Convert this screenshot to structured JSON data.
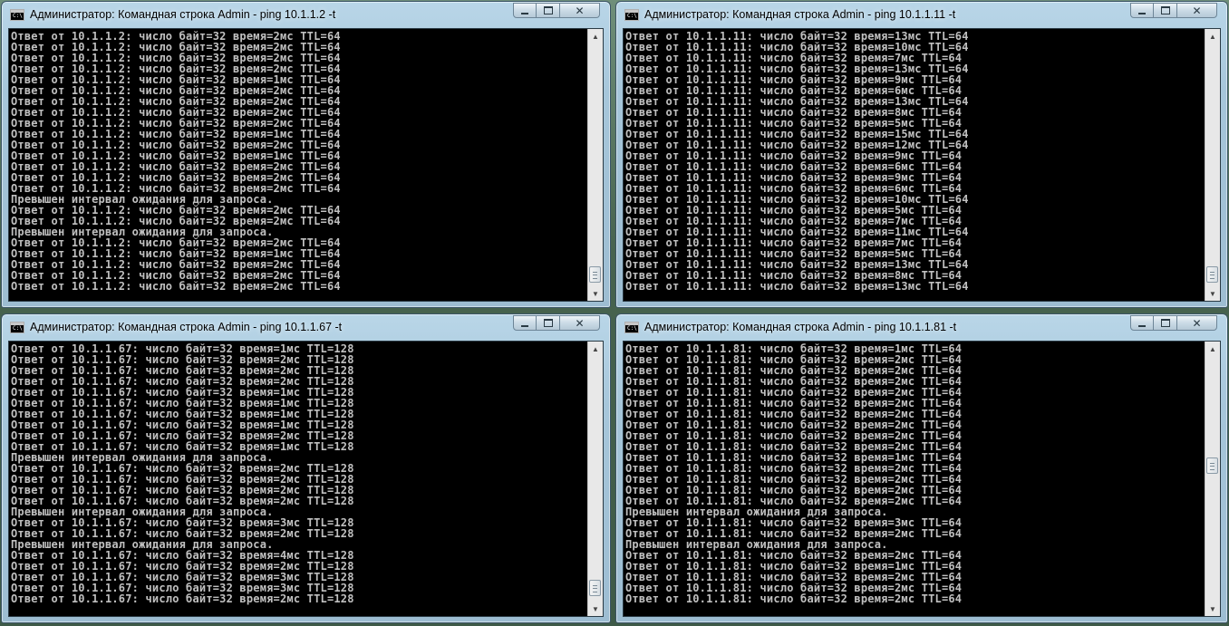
{
  "windows": [
    {
      "title": "Администратор: Командная строка Admin - ping  10.1.1.2 -t",
      "icon": "C:\\",
      "lines": [
        "Ответ от 10.1.1.2: число байт=32 время=2мс TTL=64",
        "Ответ от 10.1.1.2: число байт=32 время=2мс TTL=64",
        "Ответ от 10.1.1.2: число байт=32 время=2мс TTL=64",
        "Ответ от 10.1.1.2: число байт=32 время=2мс TTL=64",
        "Ответ от 10.1.1.2: число байт=32 время=1мс TTL=64",
        "Ответ от 10.1.1.2: число байт=32 время=2мс TTL=64",
        "Ответ от 10.1.1.2: число байт=32 время=2мс TTL=64",
        "Ответ от 10.1.1.2: число байт=32 время=2мс TTL=64",
        "Ответ от 10.1.1.2: число байт=32 время=2мс TTL=64",
        "Ответ от 10.1.1.2: число байт=32 время=1мс TTL=64",
        "Ответ от 10.1.1.2: число байт=32 время=2мс TTL=64",
        "Ответ от 10.1.1.2: число байт=32 время=1мс TTL=64",
        "Ответ от 10.1.1.2: число байт=32 время=2мс TTL=64",
        "Ответ от 10.1.1.2: число байт=32 время=2мс TTL=64",
        "Ответ от 10.1.1.2: число байт=32 время=2мс TTL=64",
        "Превышен интервал ожидания для запроса.",
        "Ответ от 10.1.1.2: число байт=32 время=2мс TTL=64",
        "Ответ от 10.1.1.2: число байт=32 время=2мс TTL=64",
        "Превышен интервал ожидания для запроса.",
        "Ответ от 10.1.1.2: число байт=32 время=2мс TTL=64",
        "Ответ от 10.1.1.2: число байт=32 время=1мс TTL=64",
        "Ответ от 10.1.1.2: число байт=32 время=2мс TTL=64",
        "Ответ от 10.1.1.2: число байт=32 время=2мс TTL=64",
        "Ответ от 10.1.1.2: число байт=32 время=2мс TTL=64"
      ]
    },
    {
      "title": "Администратор: Командная строка Admin - ping  10.1.1.11 -t",
      "icon": "C:\\",
      "lines": [
        "Ответ от 10.1.1.11: число байт=32 время=13мс TTL=64",
        "Ответ от 10.1.1.11: число байт=32 время=10мс TTL=64",
        "Ответ от 10.1.1.11: число байт=32 время=7мс TTL=64",
        "Ответ от 10.1.1.11: число байт=32 время=13мс TTL=64",
        "Ответ от 10.1.1.11: число байт=32 время=9мс TTL=64",
        "Ответ от 10.1.1.11: число байт=32 время=6мс TTL=64",
        "Ответ от 10.1.1.11: число байт=32 время=13мс TTL=64",
        "Ответ от 10.1.1.11: число байт=32 время=8мс TTL=64",
        "Ответ от 10.1.1.11: число байт=32 время=5мс TTL=64",
        "Ответ от 10.1.1.11: число байт=32 время=15мс TTL=64",
        "Ответ от 10.1.1.11: число байт=32 время=12мс TTL=64",
        "Ответ от 10.1.1.11: число байт=32 время=9мс TTL=64",
        "Ответ от 10.1.1.11: число байт=32 время=6мс TTL=64",
        "Ответ от 10.1.1.11: число байт=32 время=9мс TTL=64",
        "Ответ от 10.1.1.11: число байт=32 время=6мс TTL=64",
        "Ответ от 10.1.1.11: число байт=32 время=10мс TTL=64",
        "Ответ от 10.1.1.11: число байт=32 время=5мс TTL=64",
        "Ответ от 10.1.1.11: число байт=32 время=7мс TTL=64",
        "Ответ от 10.1.1.11: число байт=32 время=11мс TTL=64",
        "Ответ от 10.1.1.11: число байт=32 время=7мс TTL=64",
        "Ответ от 10.1.1.11: число байт=32 время=5мс TTL=64",
        "Ответ от 10.1.1.11: число байт=32 время=13мс TTL=64",
        "Ответ от 10.1.1.11: число байт=32 время=8мс TTL=64",
        "Ответ от 10.1.1.11: число байт=32 время=13мс TTL=64"
      ]
    },
    {
      "title": "Администратор: Командная строка Admin - ping  10.1.1.67 -t",
      "icon": "C:\\",
      "lines": [
        "Ответ от 10.1.1.67: число байт=32 время=1мс TTL=128",
        "Ответ от 10.1.1.67: число байт=32 время=2мс TTL=128",
        "Ответ от 10.1.1.67: число байт=32 время=2мс TTL=128",
        "Ответ от 10.1.1.67: число байт=32 время=2мс TTL=128",
        "Ответ от 10.1.1.67: число байт=32 время=1мс TTL=128",
        "Ответ от 10.1.1.67: число байт=32 время=1мс TTL=128",
        "Ответ от 10.1.1.67: число байт=32 время=1мс TTL=128",
        "Ответ от 10.1.1.67: число байт=32 время=1мс TTL=128",
        "Ответ от 10.1.1.67: число байт=32 время=2мс TTL=128",
        "Ответ от 10.1.1.67: число байт=32 время=1мс TTL=128",
        "Превышен интервал ожидания для запроса.",
        "Ответ от 10.1.1.67: число байт=32 время=2мс TTL=128",
        "Ответ от 10.1.1.67: число байт=32 время=2мс TTL=128",
        "Ответ от 10.1.1.67: число байт=32 время=2мс TTL=128",
        "Ответ от 10.1.1.67: число байт=32 время=2мс TTL=128",
        "Превышен интервал ожидания для запроса.",
        "Ответ от 10.1.1.67: число байт=32 время=3мс TTL=128",
        "Ответ от 10.1.1.67: число байт=32 время=2мс TTL=128",
        "Превышен интервал ожидания для запроса.",
        "Ответ от 10.1.1.67: число байт=32 время=4мс TTL=128",
        "Ответ от 10.1.1.67: число байт=32 время=2мс TTL=128",
        "Ответ от 10.1.1.67: число байт=32 время=3мс TTL=128",
        "Ответ от 10.1.1.67: число байт=32 время=3мс TTL=128",
        "Ответ от 10.1.1.67: число байт=32 время=2мс TTL=128"
      ]
    },
    {
      "title": "Администратор: Командная строка Admin - ping  10.1.1.81 -t",
      "icon": "C:\\",
      "lines": [
        "Ответ от 10.1.1.81: число байт=32 время=1мс TTL=64",
        "Ответ от 10.1.1.81: число байт=32 время=2мс TTL=64",
        "Ответ от 10.1.1.81: число байт=32 время=2мс TTL=64",
        "Ответ от 10.1.1.81: число байт=32 время=2мс TTL=64",
        "Ответ от 10.1.1.81: число байт=32 время=2мс TTL=64",
        "Ответ от 10.1.1.81: число байт=32 время=2мс TTL=64",
        "Ответ от 10.1.1.81: число байт=32 время=2мс TTL=64",
        "Ответ от 10.1.1.81: число байт=32 время=2мс TTL=64",
        "Ответ от 10.1.1.81: число байт=32 время=2мс TTL=64",
        "Ответ от 10.1.1.81: число байт=32 время=2мс TTL=64",
        "Ответ от 10.1.1.81: число байт=32 время=1мс TTL=64",
        "Ответ от 10.1.1.81: число байт=32 время=2мс TTL=64",
        "Ответ от 10.1.1.81: число байт=32 время=2мс TTL=64",
        "Ответ от 10.1.1.81: число байт=32 время=2мс TTL=64",
        "Ответ от 10.1.1.81: число байт=32 время=2мс TTL=64",
        "Превышен интервал ожидания для запроса.",
        "Ответ от 10.1.1.81: число байт=32 время=3мс TTL=64",
        "Ответ от 10.1.1.81: число байт=32 время=2мс TTL=64",
        "Превышен интервал ожидания для запроса.",
        "Ответ от 10.1.1.81: число байт=32 время=2мс TTL=64",
        "Ответ от 10.1.1.81: число байт=32 время=1мс TTL=64",
        "Ответ от 10.1.1.81: число байт=32 время=2мс TTL=64",
        "Ответ от 10.1.1.81: число байт=32 время=2мс TTL=64",
        "Ответ от 10.1.1.81: число байт=32 время=2мс TTL=64"
      ]
    }
  ],
  "controls": {
    "minimize": "minimize-icon",
    "maximize": "maximize-icon",
    "close": "close-icon",
    "close_glyph": "✕",
    "scroll_up": "▲",
    "scroll_down": "▼"
  },
  "colors": {
    "console_bg": "#000000",
    "console_text": "#c0c0c0",
    "frame": "#a6c6da"
  }
}
